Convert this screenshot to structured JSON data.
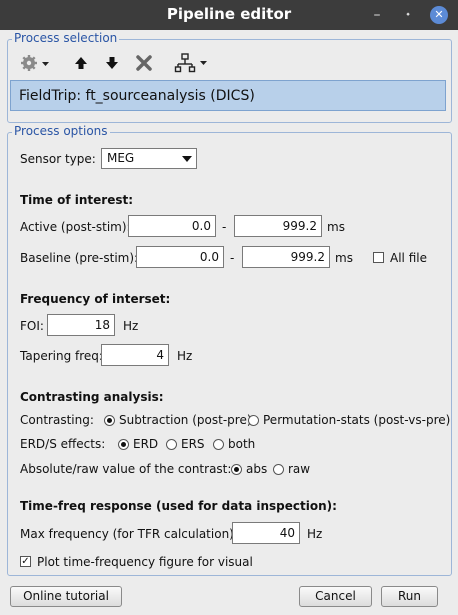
{
  "window": {
    "title": "Pipeline editor"
  },
  "process_selection": {
    "legend": "Process selection",
    "toolbar": [
      "gear-icon",
      "arrow-up-icon",
      "arrow-down-icon",
      "delete-icon",
      "tree-icon"
    ],
    "selected_process": "FieldTrip: ft_sourceanalysis (DICS)"
  },
  "process_options": {
    "legend": "Process options",
    "sensor_type_label": "Sensor type:",
    "sensor_type_value": "MEG",
    "time": {
      "header": "Time of interest:",
      "active_label": "Active (post-stim):",
      "active_start": "0.0",
      "active_end": "999.2",
      "baseline_label": "Baseline (pre-stim):",
      "baseline_start": "0.0",
      "baseline_end": "999.2",
      "dash": "-",
      "unit": "ms",
      "all_file_label": "All file"
    },
    "freq": {
      "header": "Frequency of interset:",
      "foi_label": "FOI:",
      "foi_value": "18",
      "tapering_label": "Tapering freq:",
      "tapering_value": "4",
      "unit": "Hz"
    },
    "contrast": {
      "header": "Contrasting analysis:",
      "contrasting_label": "Contrasting:",
      "opt_subtraction": "Subtraction (post-pre)",
      "opt_permutation": "Permutation-stats (post-vs-pre)",
      "erds_label": "ERD/S effects:",
      "opt_erd": "ERD",
      "opt_ers": "ERS",
      "opt_both": "both",
      "absraw_label": "Absolute/raw value of the contrast:",
      "opt_abs": "abs",
      "opt_raw": "raw"
    },
    "tfr": {
      "header": "Time-freq response (used for data inspection):",
      "max_freq_label": "Max frequency (for TFR calculation):",
      "max_freq_value": "40",
      "unit": "Hz",
      "plot_label": "Plot time-frequency figure for visual"
    }
  },
  "buttons": {
    "tutorial": "Online tutorial",
    "cancel": "Cancel",
    "run": "Run"
  }
}
